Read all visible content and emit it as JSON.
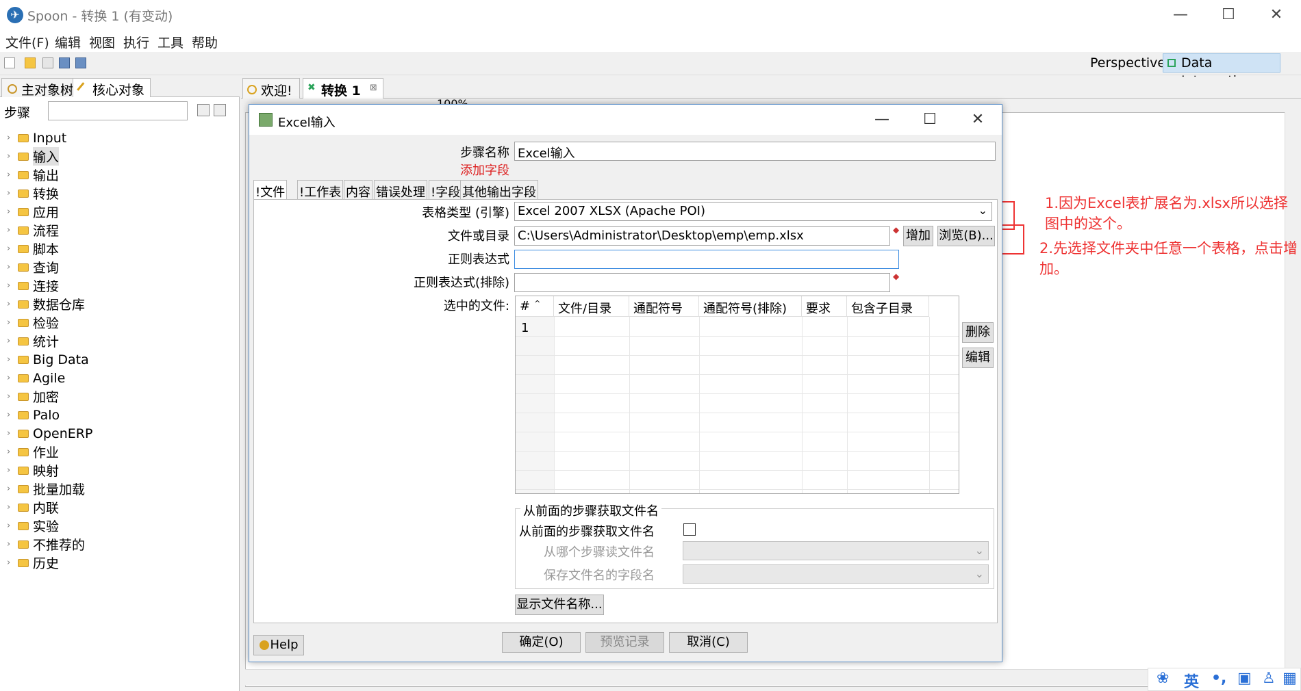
{
  "window": {
    "title": "Spoon - 转换 1 (有变动)"
  },
  "menu": [
    "文件(F)",
    "编辑",
    "视图",
    "执行",
    "工具",
    "帮助"
  ],
  "perspective": {
    "label": "Perspective:",
    "value": "Data Integration"
  },
  "left_panel": {
    "tabs": [
      "主对象树",
      "核心对象"
    ],
    "steps_label": "步骤",
    "tree": [
      "Input",
      "输入",
      "输出",
      "转换",
      "应用",
      "流程",
      "脚本",
      "查询",
      "连接",
      "数据仓库",
      "检验",
      "统计",
      "Big Data",
      "Agile",
      "加密",
      "Palo",
      "OpenERP",
      "作业",
      "映射",
      "批量加载",
      "内联",
      "实验",
      "不推荐的",
      "历史"
    ]
  },
  "editor_tabs": [
    "欢迎!",
    "转换 1"
  ],
  "canvas_toolbar": {
    "zoom": "100%"
  },
  "dialog": {
    "title": "Excel输入",
    "step_name_label": "步骤名称",
    "step_name_value": "Excel输入",
    "add_field_link": "添加字段",
    "tabs": [
      "!文件",
      "!工作表",
      "内容",
      "错误处理",
      "!字段",
      "其他输出字段"
    ],
    "engine_label": "表格类型 (引擎)",
    "engine_value": "Excel 2007 XLSX (Apache POI)",
    "file_label": "文件或目录",
    "file_value": "C:\\Users\\Administrator\\Desktop\\emp\\emp.xlsx",
    "add_button": "增加",
    "browse_button": "浏览(B)...",
    "regex_label": "正则表达式",
    "regex_value": "",
    "regex_exclude_label": "正则表达式(排除)",
    "regex_exclude_value": "",
    "selected_files_label": "选中的文件:",
    "table": {
      "columns": [
        "#",
        "文件/目录",
        "通配符号",
        "通配符号(排除)",
        "要求",
        "包含子目录"
      ],
      "rows": [
        [
          "1",
          "",
          "",
          "",
          "",
          ""
        ]
      ]
    },
    "delete_button": "删除",
    "edit_button": "编辑",
    "group_title": "从前面的步骤获取文件名",
    "from_prev_label": "从前面的步骤获取文件名",
    "from_prev_checked": false,
    "read_step_label": "从哪个步骤读文件名",
    "save_field_label": "保存文件名的字段名",
    "show_files_button": "显示文件名称...",
    "help_button": "Help",
    "ok_button": "确定(O)",
    "preview_button": "预览记录",
    "cancel_button": "取消(C)"
  },
  "annotations": [
    "1.因为Excel表扩展名为.xlsx所以选择图中的这个。",
    "2.先选择文件夹中任意一个表格，点击增加。"
  ],
  "ime": {
    "label": "英"
  },
  "colors": {
    "annotation": "#ee3333",
    "link": "#dd2222",
    "selection": "#cfe3f5"
  }
}
